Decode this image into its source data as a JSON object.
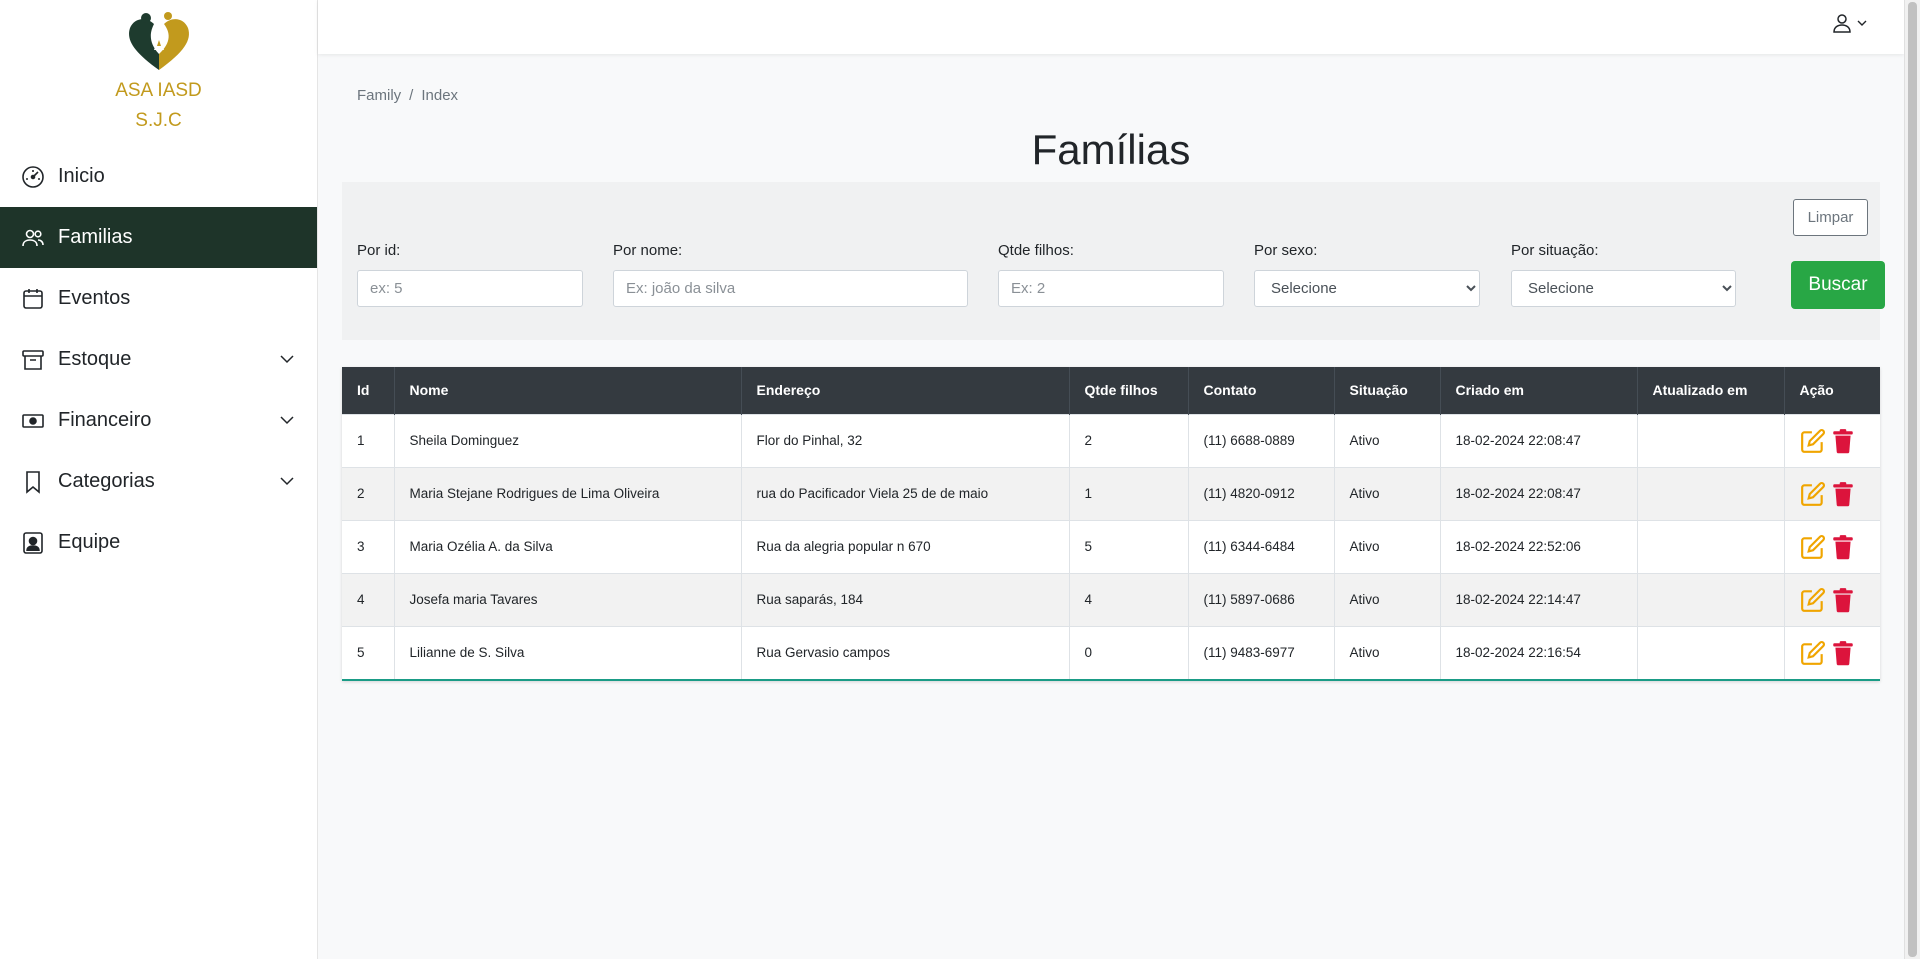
{
  "brand": {
    "line1": "ASA IASD",
    "line2": "S.J.C",
    "logo_icon": "asa-heart-logo-icon"
  },
  "sidebar": {
    "items": [
      {
        "label": "Inicio",
        "icon": "speedometer-icon",
        "active": false,
        "expandable": false
      },
      {
        "label": "Familias",
        "icon": "people-icon",
        "active": true,
        "expandable": false
      },
      {
        "label": "Eventos",
        "icon": "calendar-icon",
        "active": false,
        "expandable": false
      },
      {
        "label": "Estoque",
        "icon": "archive-box-icon",
        "active": false,
        "expandable": true
      },
      {
        "label": "Financeiro",
        "icon": "cash-icon",
        "active": false,
        "expandable": true
      },
      {
        "label": "Categorias",
        "icon": "bookmark-icon",
        "active": false,
        "expandable": true
      },
      {
        "label": "Equipe",
        "icon": "person-badge-icon",
        "active": false,
        "expandable": false
      }
    ]
  },
  "topbar": {
    "user_icon": "person-icon",
    "dropdown_icon": "chevron-down-icon"
  },
  "breadcrumb": {
    "items": [
      "Family",
      "Index"
    ],
    "separator": "/"
  },
  "page": {
    "title": "Famílias"
  },
  "filters": {
    "id": {
      "label": "Por id:",
      "placeholder": "ex: 5"
    },
    "nome": {
      "label": "Por nome:",
      "placeholder": "Ex: joão da silva"
    },
    "filhos": {
      "label": "Qtde filhos:",
      "placeholder": "Ex: 2"
    },
    "sexo": {
      "label": "Por sexo:",
      "selected": "Selecione"
    },
    "situacao": {
      "label": "Por situação:",
      "selected": "Selecione"
    },
    "clear_label": "Limpar",
    "search_label": "Buscar"
  },
  "table": {
    "columns": [
      "Id",
      "Nome",
      "Endereço",
      "Qtde filhos",
      "Contato",
      "Situação",
      "Criado em",
      "Atualizado em",
      "Ação"
    ],
    "rows": [
      {
        "id": "1",
        "nome": "Sheila Dominguez",
        "endereco": "Flor do Pinhal, 32",
        "filhos": "2",
        "contato": "(11) 6688-0889",
        "situacao": "Ativo",
        "criado": "18-02-2024 22:08:47",
        "atualizado": ""
      },
      {
        "id": "2",
        "nome": "Maria Stejane Rodrigues de Lima Oliveira",
        "endereco": "rua do Pacificador Viela 25 de de maio",
        "filhos": "1",
        "contato": "(11) 4820-0912",
        "situacao": "Ativo",
        "criado": "18-02-2024 22:08:47",
        "atualizado": ""
      },
      {
        "id": "3",
        "nome": "Maria Ozélia A. da Silva",
        "endereco": "Rua da alegria popular n 670",
        "filhos": "5",
        "contato": "(11) 6344-6484",
        "situacao": "Ativo",
        "criado": "18-02-2024 22:52:06",
        "atualizado": ""
      },
      {
        "id": "4",
        "nome": "Josefa maria Tavares",
        "endereco": "Rua saparás, 184",
        "filhos": "4",
        "contato": "(11) 5897-0686",
        "situacao": "Ativo",
        "criado": "18-02-2024 22:14:47",
        "atualizado": ""
      },
      {
        "id": "5",
        "nome": "Lilianne de S. Silva",
        "endereco": "Rua Gervasio campos",
        "filhos": "0",
        "contato": "(11) 9483-6977",
        "situacao": "Ativo",
        "criado": "18-02-2024 22:16:54",
        "atualizado": ""
      }
    ],
    "action_icons": [
      "edit-icon",
      "trash-icon"
    ]
  },
  "colors": {
    "sidebar_active": "#1e3429",
    "brand_gold": "#c29a1d",
    "table_header": "#343a40",
    "search_button": "#28a745",
    "edit_icon": "#f0a500",
    "delete_icon": "#dc143c"
  }
}
